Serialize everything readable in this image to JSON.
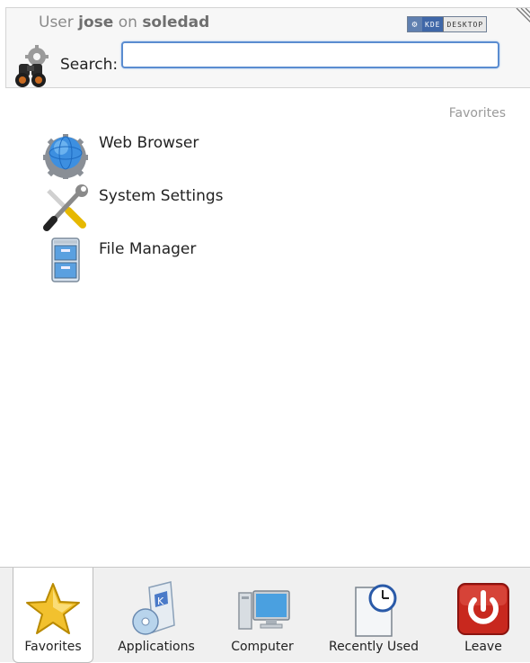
{
  "header": {
    "user_prefix": "User",
    "username": "jose",
    "on_word": "on",
    "hostname": "soledad",
    "badge_left": "KDE",
    "badge_right": "DESKTOP"
  },
  "search": {
    "label": "Search:",
    "value": "",
    "placeholder": ""
  },
  "favorites": {
    "title": "Favorites",
    "items": [
      {
        "label": "Web Browser",
        "icon": "globe-gear-icon"
      },
      {
        "label": "System Settings",
        "icon": "wrench-screwdriver-icon"
      },
      {
        "label": "File Manager",
        "icon": "file-cabinet-icon"
      }
    ]
  },
  "tabs": [
    {
      "label": "Favorites",
      "icon": "star-icon",
      "active": true
    },
    {
      "label": "Applications",
      "icon": "applications-box-icon",
      "active": false
    },
    {
      "label": "Computer",
      "icon": "computer-monitor-icon",
      "active": false
    },
    {
      "label": "Recently Used",
      "icon": "document-clock-icon",
      "active": false
    },
    {
      "label": "Leave",
      "icon": "power-icon",
      "active": false
    }
  ],
  "colors": {
    "accent": "#5a8cd0",
    "leave_red": "#c8281e",
    "star_yellow": "#f2c12e"
  }
}
